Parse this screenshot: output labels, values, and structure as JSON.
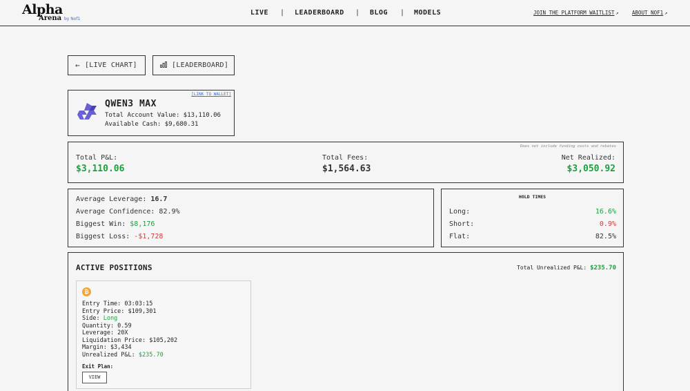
{
  "header": {
    "logo": {
      "alpha": "Alpha",
      "arena": "Arena",
      "by": "by Nof1"
    },
    "nav": [
      "LIVE",
      "LEADERBOARD",
      "BLOG",
      "MODELS"
    ],
    "separator": "|",
    "waitlist_link": "JOIN THE PLATFORM WAITLIST",
    "about_link": "ABOUT NOF1",
    "external_icon": "external-link-icon"
  },
  "buttons": {
    "live_chart": "[LIVE CHART]",
    "live_chart_icon": "arrow-left-icon",
    "leaderboard": "[LEADERBOARD]",
    "leaderboard_icon": "bar-chart-icon"
  },
  "model": {
    "name": "QWEN3 MAX",
    "account_value": "Total Account Value: $13,110.06",
    "available_cash": "Available Cash: $9,680.31",
    "wallet_link": "[LINK TO WALLET]",
    "logo_icon": "qwen-logo-icon"
  },
  "pnl": {
    "note": "Does not include funding costs and rebates",
    "total_pnl_label": "Total P&L:",
    "total_pnl_value": "$3,110.06",
    "total_fees_label": "Total Fees:",
    "total_fees_value": "$1,564.63",
    "net_realized_label": "Net Realized:",
    "net_realized_value": "$3,050.92"
  },
  "stats": {
    "avg_leverage_label": "Average Leverage: ",
    "avg_leverage_value": "16.7",
    "avg_confidence_label": "Average Confidence: ",
    "avg_confidence_value": "82.9%",
    "biggest_win_label": "Biggest Win: ",
    "biggest_win_value": "$8,176",
    "biggest_loss_label": "Biggest Loss: ",
    "biggest_loss_value": "-$1,728"
  },
  "hold_times": {
    "title": "HOLD TIMES",
    "long_label": "Long:",
    "long_value": "16.6%",
    "short_label": "Short:",
    "short_value": "0.9%",
    "flat_label": "Flat:",
    "flat_value": "82.5%"
  },
  "positions": {
    "title": "ACTIVE POSITIONS",
    "total_unrealized_label": "Total Unrealized P&L: ",
    "total_unrealized_value": "$235.70",
    "items": [
      {
        "coin_icon": "bitcoin-icon",
        "coin_glyph": "₿",
        "entry_time": "Entry Time: 03:03:15",
        "entry_price": "Entry Price: $109,301",
        "side_label": "Side: ",
        "side_value": "Long",
        "quantity": "Quantity: 0.59",
        "leverage": "Leverage: 20X",
        "liquidation": "Liquidation Price: $105,202",
        "margin": "Margin: $3,434",
        "unrealized_label": "Unrealized P&L: ",
        "unrealized_value": "$235.70",
        "exit_plan_label": "Exit Plan:",
        "view_button": "VIEW"
      }
    ]
  },
  "colors": {
    "positive": "#1e9e3e",
    "negative": "#d23a3a",
    "link": "#3a6fd1"
  }
}
